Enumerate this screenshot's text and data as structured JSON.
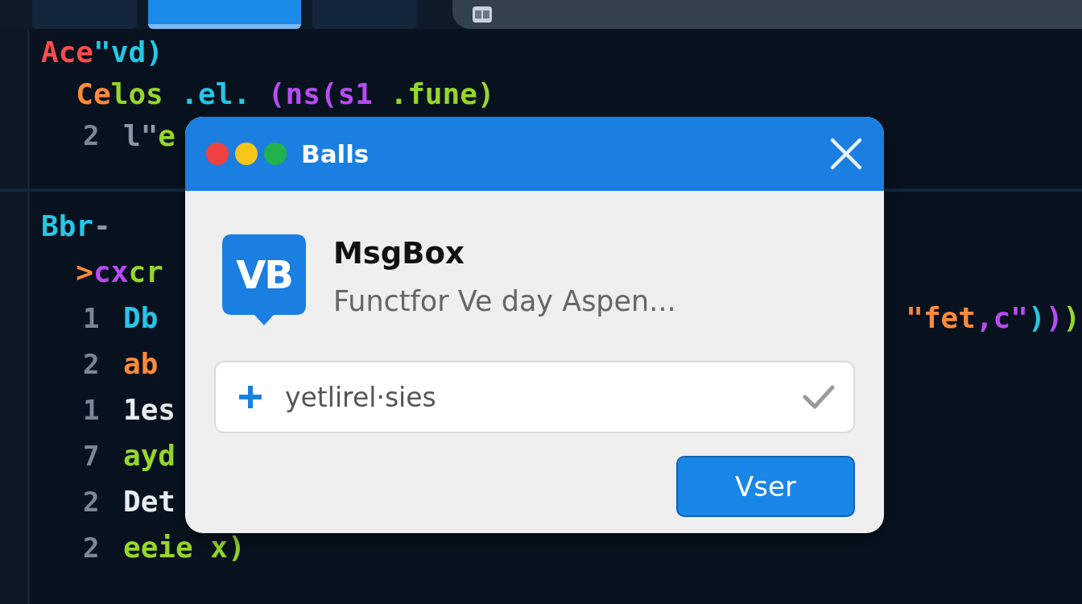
{
  "editor_tabs": [
    {
      "selected": false
    },
    {
      "selected": true
    },
    {
      "selected": false
    }
  ],
  "address_bar": {
    "kind": "bar"
  },
  "top_pane": {
    "lines": [
      {
        "tokens": [
          {
            "text": "Ace",
            "color": "#ff4b4b"
          },
          {
            "text": "\"vd)",
            "color": "#26c6e6"
          }
        ]
      },
      {
        "tokens": [
          {
            "text": "  Ce",
            "color": "#ff8a3a"
          },
          {
            "text": "los",
            "color": "#95d62c"
          },
          {
            "text": " .el. ",
            "color": "#26c6e6"
          },
          {
            "text": "(ns(s1",
            "color": "#b64cf2"
          },
          {
            "text": " .fune)",
            "color": "#95d62c"
          }
        ]
      },
      {
        "number": "2",
        "tokens": [
          {
            "text": "l\"",
            "color": "#8a96a6"
          },
          {
            "text": "e",
            "color": "#95d62c"
          }
        ]
      }
    ]
  },
  "bottom_pane": {
    "lines": [
      {
        "tokens": [
          {
            "text": "Bbr",
            "color": "#26c6e6"
          },
          {
            "text": "-",
            "color": "#8a96a6"
          }
        ]
      },
      {
        "tokens": [
          {
            "text": "  >",
            "color": "#ff8a3a"
          },
          {
            "text": "cx",
            "color": "#b64cf2"
          },
          {
            "text": "cr",
            "color": "#95d62c"
          }
        ]
      },
      {
        "number": "1",
        "tokens": [
          {
            "text": "Db",
            "color": "#26c6e6"
          }
        ],
        "trailing": [
          {
            "text": "\"fet",
            "color": "#ff8a3a"
          },
          {
            "text": ",c\"",
            "color": "#b64cf2"
          },
          {
            "text": ")",
            "color": "#26c6e6"
          },
          {
            "text": ")",
            "color": "#b64cf2"
          },
          {
            "text": ")",
            "color": "#95d62c"
          }
        ]
      },
      {
        "number": "2",
        "tokens": [
          {
            "text": "ab",
            "color": "#ff8a3a"
          }
        ]
      },
      {
        "number": "1",
        "tokens": [
          {
            "text": "1es",
            "color": "#e8edf2"
          }
        ]
      },
      {
        "number": "7",
        "tokens": [
          {
            "text": "ayd",
            "color": "#95d62c"
          }
        ]
      },
      {
        "number": "2",
        "tokens": [
          {
            "text": "Det",
            "color": "#e8edf2"
          }
        ]
      },
      {
        "number": "2",
        "tokens": [
          {
            "text": "eeie x)",
            "color": "#95d62c"
          }
        ]
      }
    ]
  },
  "dialog": {
    "title": "Balls",
    "window_controls": [
      {
        "color": "#f04040"
      },
      {
        "color": "#f5c518"
      },
      {
        "color": "#22b24c"
      }
    ],
    "app_icon_label": "VB",
    "heading": "MsgBox",
    "message": "Functfor Ve day Aspen...",
    "field": {
      "value": "yetlirel·sies",
      "checked": true
    },
    "button": "Vser"
  }
}
